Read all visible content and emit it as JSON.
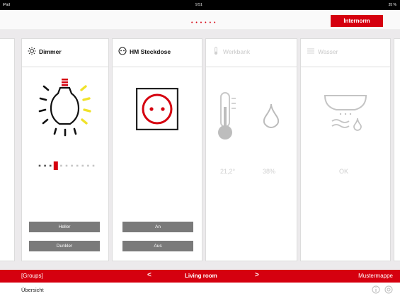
{
  "status_bar": {
    "left": "iPad",
    "time": "9:51",
    "right": "35 %"
  },
  "header": {
    "page_dots": "• • • • • •",
    "brand": "Internorm"
  },
  "cards": {
    "dimmer": {
      "title": "Dimmer",
      "button_1": "Heller",
      "button_2": "Dunkler",
      "level": 0.3
    },
    "steckdose": {
      "title": "HM Steckdose",
      "button_1": "An",
      "button_2": "Aus"
    },
    "werkbank": {
      "title": "Werkbank",
      "temperature": "21,2°",
      "humidity": "38%"
    },
    "wasser": {
      "title": "Wasser",
      "status": "OK"
    }
  },
  "navbar": {
    "groups": "[Groups]",
    "prev": "<",
    "room": "Living room",
    "next": ">",
    "project": "Mustermappe"
  },
  "bottom": {
    "label": "Übersicht"
  },
  "colors": {
    "accent": "#d5000f",
    "bulb_rays": "#f0e22a",
    "button": "#7a7a7a",
    "disabled": "#cfcfcf"
  },
  "icons": [
    "sun-icon",
    "socket-icon",
    "thermometer-icon",
    "water-sensor-icon",
    "lightbulb-icon",
    "power-outlet-icon",
    "drop-icon",
    "info-icon",
    "settings-icon"
  ]
}
